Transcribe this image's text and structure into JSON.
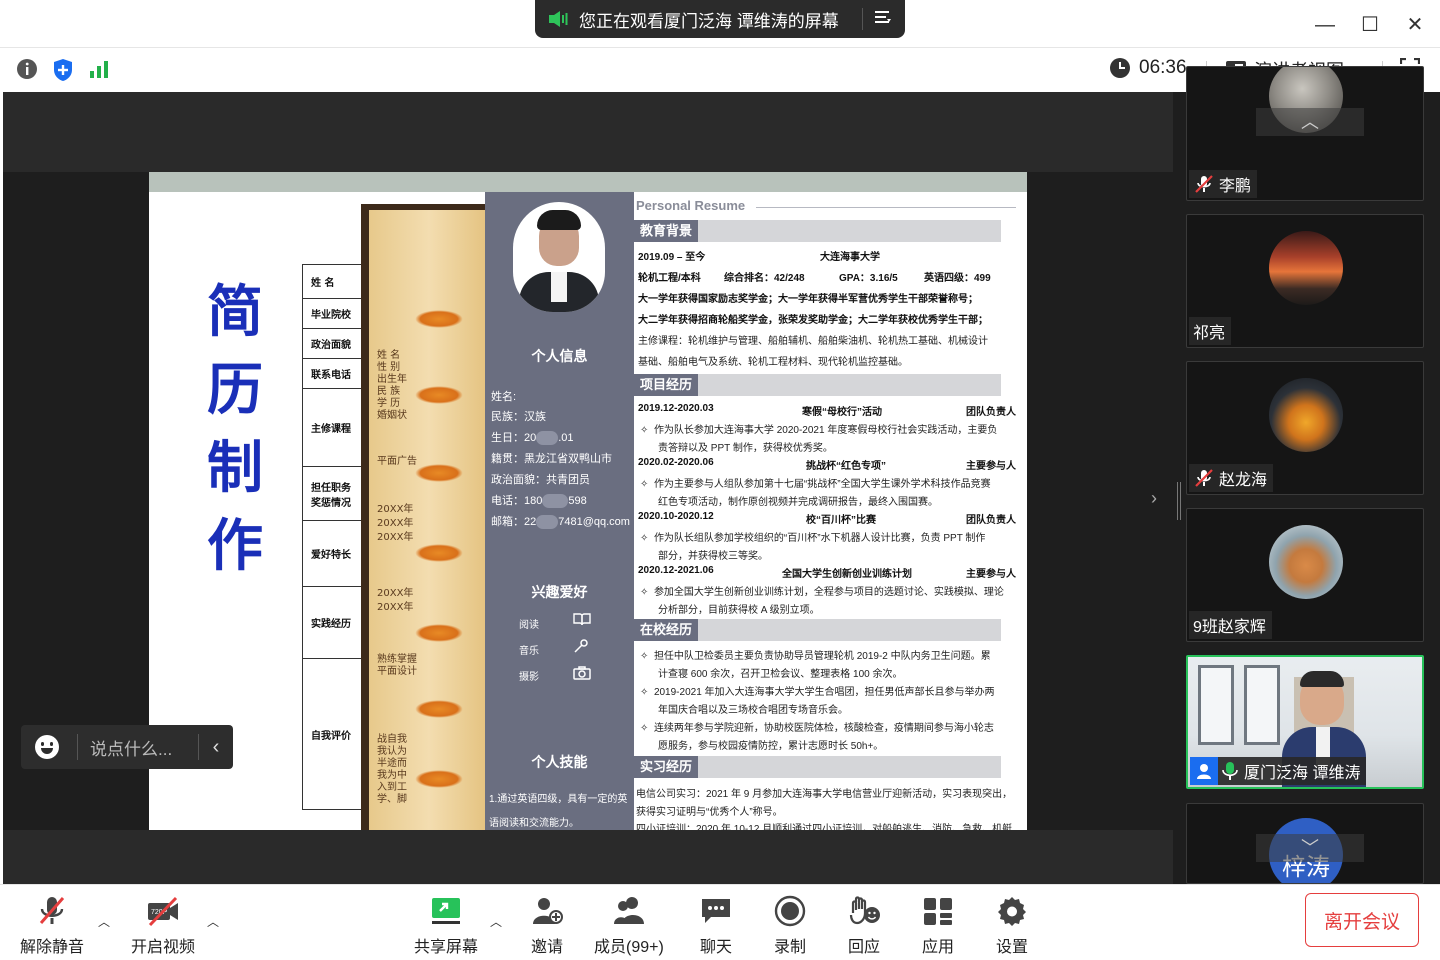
{
  "title_bar": {
    "share_banner": "您正在观看厦门泛海 谭维涛的屏幕",
    "minimize_label": "—",
    "maximize_label": "☐",
    "close_label": "✕"
  },
  "top_toolbar": {
    "timer": "06:36",
    "view_label": "演讲者视图"
  },
  "shared_content": {
    "cover_chars": [
      "简",
      "历",
      "制",
      "作"
    ],
    "form_rows": [
      "姓 名",
      "毕业院校",
      "政治面貌",
      "联系电话",
      "主修课程",
      "担任职务\n奖惩情况",
      "爱好特长",
      "实践经历",
      "自我评价"
    ],
    "scroll_labels": [
      "姓  名",
      "性  别",
      "出生年",
      "民  族",
      "学  历",
      "婚姻状",
      "平面广告",
      "20XX年",
      "20XX年",
      "20XX年",
      "20XX年",
      "20XX年",
      "熟练掌握",
      "平面设计",
      "战自我",
      "我认为",
      "半途而",
      "我为中",
      "入到工",
      "学、脚"
    ],
    "resume": {
      "header": "Personal Resume",
      "side": {
        "info_title": "个人信息",
        "name_label": "姓名:",
        "ethnicity": "民族：汉族",
        "birth_prefix": "生日：20",
        "birth_suffix": ".01",
        "origin": "籍贯：黑龙江省双鸭山市",
        "political": "政治面貌：共青团员",
        "phone_prefix": "电话：180",
        "phone_suffix": "598",
        "email_prefix": "邮箱：22",
        "email_suffix": "7481@qq.com",
        "hobby_title": "兴趣爱好",
        "hobbies": [
          "阅读",
          "音乐",
          "摄影"
        ],
        "skill_title": "个人技能",
        "skill_1": "1.通过英语四级，具有一定的英",
        "skill_2": "语阅读和交流能力。"
      },
      "education": {
        "title": "教育背景",
        "period": "2019.09 – 至今",
        "school": "大连海事大学",
        "major": "轮机工程/本科",
        "rank": "综合排名：42/248",
        "gpa": "GPA：3.16/5",
        "cet": "英语四级：499",
        "award_1": "大一学年获得国家励志奖学金；大一学年获得半军营优秀学生干部荣誉称号；",
        "award_2": "大二学年获得招商轮船奖学金，张荣发奖助学金；大二学年获校优秀学生干部；",
        "courses_1": "主修课程：轮机维护与管理、船舶辅机、船舶柴油机、轮机热工基础、机械设计",
        "courses_2": "基础、船舶电气及系统、轮机工程材料、现代轮机监控基础。"
      },
      "projects": {
        "title": "项目经历",
        "items": [
          {
            "period": "2019.12-2020.03",
            "name": "寒假“母校行”活动",
            "role": "团队负责人",
            "desc_1": "作为队长参加大连海事大学 2020-2021 年度寒假母校行社会实践活动，主要负",
            "desc_2": "责答辩以及 PPT 制作，获得校优秀奖。"
          },
          {
            "period": "2020.02-2020.06",
            "name": "挑战杯“红色专项”",
            "role": "主要参与人",
            "desc_1": "作为主要参与人组队参加第十七届“挑战杯”全国大学生课外学术科技作品竞赛",
            "desc_2": "红色专项活动，制作原创视频并完成调研报告，最终入围国赛。"
          },
          {
            "period": "2020.10-2020.12",
            "name": "校“百川杯”比赛",
            "role": "团队负责人",
            "desc_1": "作为队长组队参加学校组织的“百川杯”水下机器人设计比赛，负责 PPT 制作",
            "desc_2": "部分，并获得校三等奖。"
          },
          {
            "period": "2020.12-2021.06",
            "name": "全国大学生创新创业训练计划",
            "role": "主要参与人",
            "desc_1": "参加全国大学生创新创业训练计划，全程参与项目的选题讨论、实践模拟、理论",
            "desc_2": "分析部分，目前获得校 A 级别立项。"
          }
        ]
      },
      "campus": {
        "title": "在校经历",
        "lines": [
          "担任中队卫检委员主要负责协助导员管理轮机 2019-2 中队内务卫生问题。累",
          "计查寝 600 余次，召开卫检会议、整理表格 100 余次。",
          "2019-2021 年加入大连海事大学大学生合唱团，担任男低声部长且参与举办两",
          "年国庆合唱以及三场校合唱团专场音乐会。",
          "连续两年参与学院迎新，协助校医院体检，核酸检查，疫情期间参与海小轮志",
          "愿服务，参与校园疫情防控，累计志愿时长 50h+。"
        ]
      },
      "internship": {
        "title": "实习经历",
        "line_1": "电信公司实习：2021 年 9 月参加大连海事大学电信营业厅迎新活动，实习表现突出，",
        "line_2": "获得实习证明与“优秀个人”称号。",
        "line_3": "四小证培训：2020 年 10-12 月顺利通过四小证培训，对船舶逃生、消防、急救、机艇"
      }
    }
  },
  "chat_bubble": {
    "placeholder": "说点什么..."
  },
  "participants": [
    {
      "name": "李鹏",
      "muted": true
    },
    {
      "name": "祁亮",
      "muted": false
    },
    {
      "name": "赵龙海",
      "muted": true
    },
    {
      "name": "9班赵家辉",
      "muted": false
    },
    {
      "name": "厦门泛海 谭维涛",
      "muted": false,
      "active": true
    },
    {
      "name": "梓涛",
      "muted": false
    }
  ],
  "bottom_toolbar": {
    "unmute": "解除静音",
    "start_video": "开启视频",
    "share_screen": "共享屏幕",
    "invite": "邀请",
    "members": "成员(99+)",
    "chat": "聊天",
    "record": "录制",
    "reaction": "回应",
    "apps": "应用",
    "settings": "设置",
    "leave": "离开会议"
  },
  "colors": {
    "share_green": "#27c25a",
    "leave_red": "#e53e3e",
    "resume_slate": "#6a6e80",
    "cover_blue": "#1a2fb8"
  }
}
